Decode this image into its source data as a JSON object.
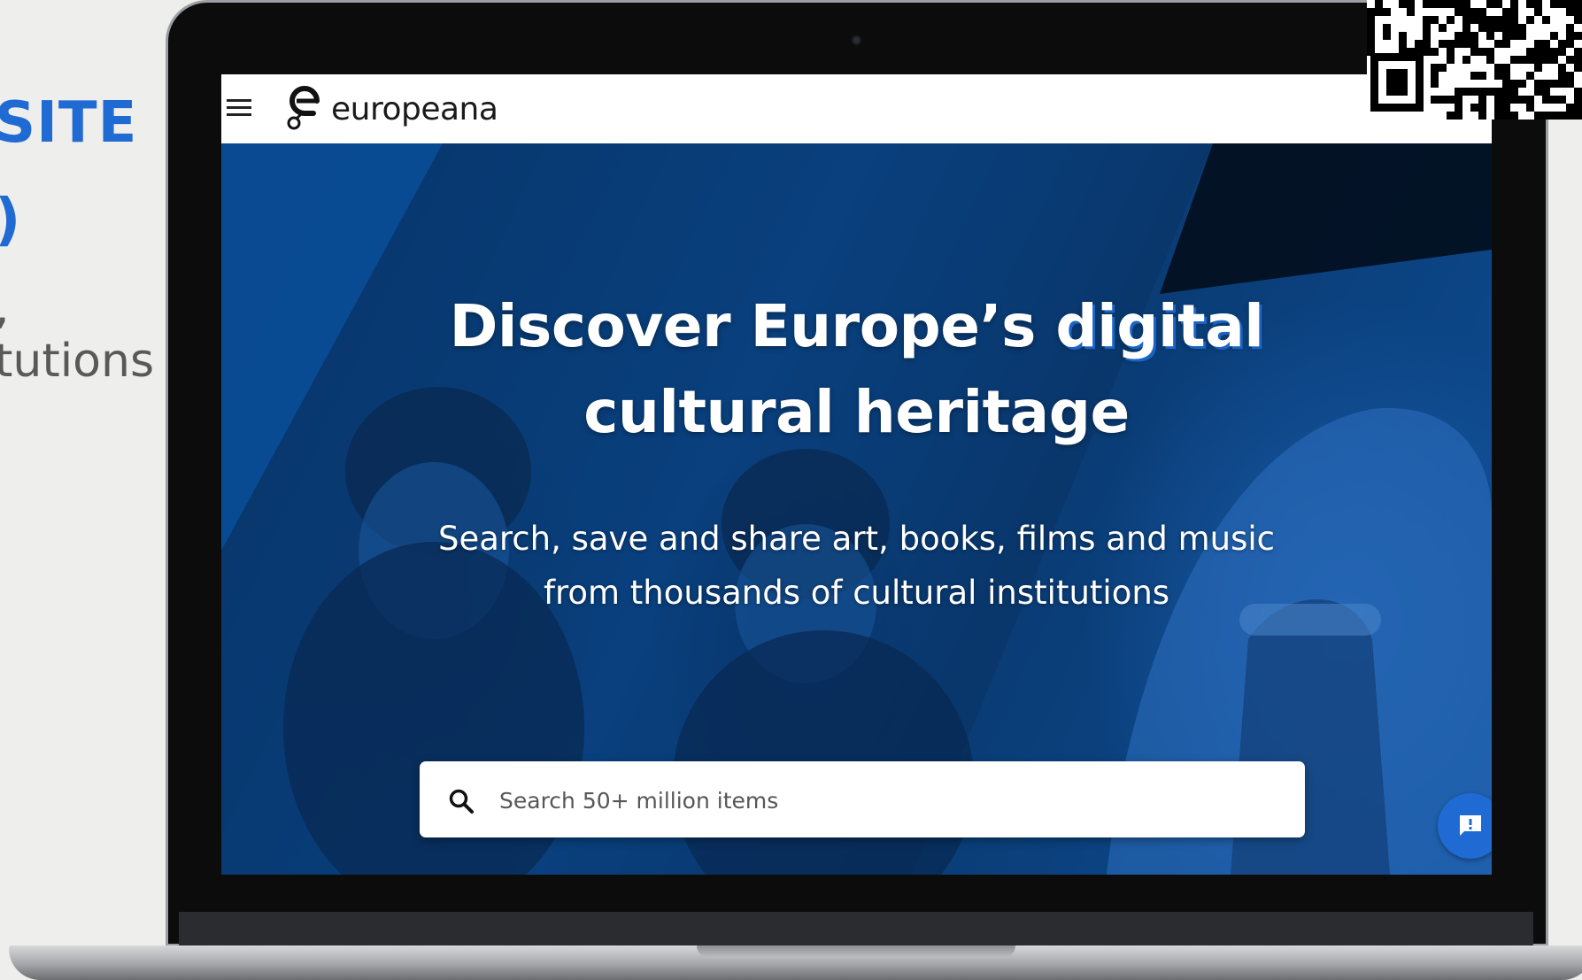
{
  "slide": {
    "title_lines": [
      "SITE",
      ")"
    ],
    "body_lines": [
      ",",
      "tutions"
    ]
  },
  "site": {
    "brand_name": "europeana",
    "hero": {
      "heading_line1_start": "Discover Europe’s ",
      "heading_line1_accent": "digital",
      "heading_line2": "cultural heritage",
      "subtitle_line1": "Search, save and share art, books, films and music",
      "subtitle_line2": "from thousands of cultural institutions"
    },
    "search": {
      "placeholder": "Search 50+ million items",
      "value": ""
    }
  },
  "icons": {
    "menu": "hamburger-menu-icon",
    "logo": "europeana-logo",
    "search": "search-icon",
    "feedback": "feedback-icon"
  },
  "colors": {
    "slide_accent": "#1f6ad3",
    "hero_overlay": "#0b4a92",
    "heading_accent_shadow": "#1b64c4",
    "feedback_button": "#1f6ad3"
  }
}
